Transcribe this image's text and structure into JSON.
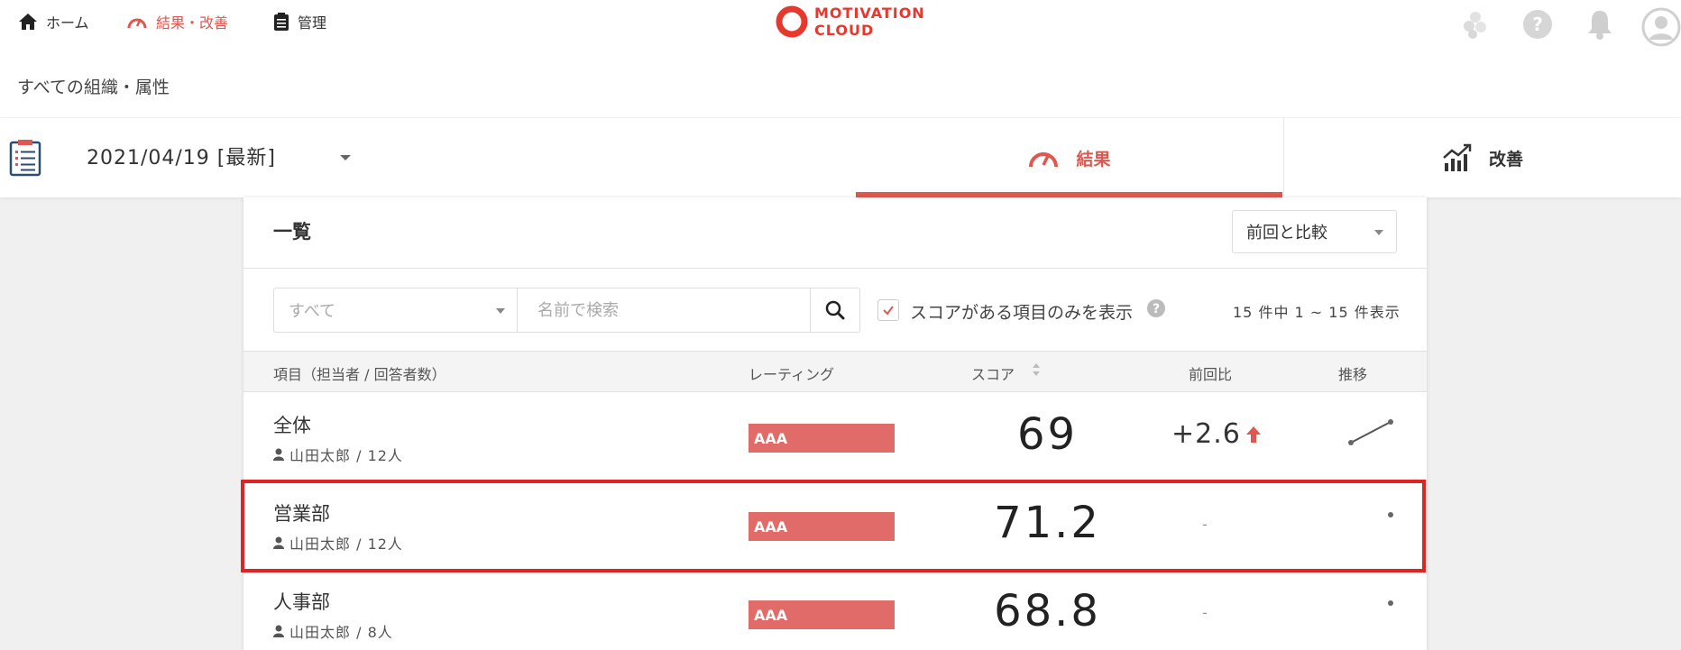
{
  "nav": {
    "home_label": "ホーム",
    "results_label": "結果・改善",
    "manage_label": "管理"
  },
  "logo": {
    "line1": "MOTIVATION",
    "line2": "CLOUD"
  },
  "top_icons": [
    "puzzle-icon",
    "help-icon",
    "bell-icon",
    "avatar-icon"
  ],
  "breadcrumb": "すべての組織・属性",
  "survey": {
    "date_label": "2021/04/19 [最新]"
  },
  "tabs": {
    "results": "結果",
    "improve": "改善"
  },
  "card": {
    "title": "一覧",
    "compare_label": "前回と比較"
  },
  "filters": {
    "category": "すべて",
    "search_placeholder": "名前で検索",
    "score_only_label": "スコアがある項目のみを表示",
    "score_only_checked": true,
    "result_count": "15 件中 1 ~ 15 件表示"
  },
  "table": {
    "headers": {
      "item": "項目（担当者 / 回答者数）",
      "rating": "レーティング",
      "score": "スコア",
      "diff": "前回比",
      "trend": "推移"
    },
    "rows": [
      {
        "name": "全体",
        "owner": "山田太郎 / 12人",
        "rating": "AAA",
        "score": "69",
        "diff": "+2.6",
        "trend": "line-up"
      },
      {
        "name": "営業部",
        "owner": "山田太郎 / 12人",
        "rating": "AAA",
        "score": "71.2",
        "diff": "-",
        "trend": "point"
      },
      {
        "name": "人事部",
        "owner": "山田太郎 / 8人",
        "rating": "AAA",
        "score": "68.8",
        "diff": "-",
        "trend": "point"
      }
    ]
  },
  "colors": {
    "accent": "#e0574f",
    "rating_bar": "#e06b69",
    "highlight": "#e02424",
    "logo": "#e8382e"
  }
}
